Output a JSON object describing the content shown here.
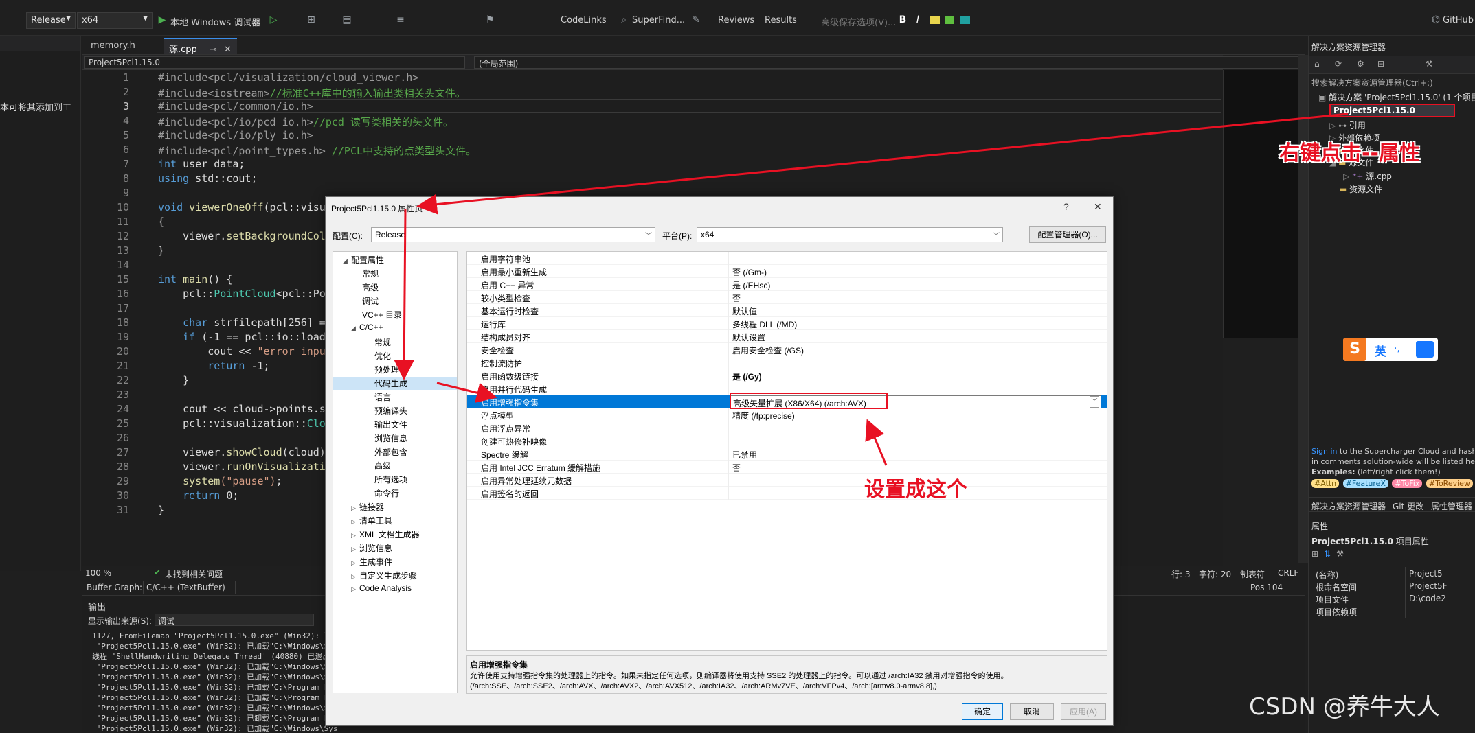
{
  "toolbar": {
    "config": "Release",
    "platform": "x64",
    "debugger": "本地 Windows 调试器",
    "codelinks": "CodeLinks",
    "superfind": "SuperFind...",
    "reviews": "Reviews",
    "results": "Results",
    "savecache": "高级保存选项(V)...",
    "github": "GitHub"
  },
  "left_panel": {
    "hint": "本可将其添加到工"
  },
  "editor": {
    "tabs": [
      "memory.h",
      "源.cpp"
    ],
    "nav_left": "Project5Pcl1.15.0",
    "nav_right": "(全局范围)",
    "line_numbers": [
      "1",
      "2",
      "3",
      "4",
      "5",
      "6",
      "7",
      "8",
      "9",
      "10",
      "11",
      "12",
      "13",
      "14",
      "15",
      "16",
      "17",
      "18",
      "19",
      "20",
      "21",
      "22",
      "23",
      "24",
      "25",
      "26",
      "27",
      "28",
      "29",
      "30",
      "31"
    ],
    "lines": {
      "l1": "#include<pcl/visualization/cloud_viewer.h>",
      "l2a": "#include<iostream>",
      "l2b": "//标准C++库中的输入输出类相关头文件。",
      "l3": "#include<pcl/common/io.h>",
      "l4a": "#include<pcl/io/pcd_io.h>",
      "l4b": "//pcd 读写类相关的头文件。",
      "l5": "#include<pcl/io/ply_io.h>",
      "l6a": "#include<pcl/point_types.h> ",
      "l6b": "//PCL中支持的点类型头文件。",
      "l7a": "int",
      "l7b": " user_data;",
      "l8a": "using",
      "l8b": " std::cout;",
      "l10a": "void",
      "l10b": "viewerOneOff",
      "l10c": "(pcl::visu",
      "l11": "{",
      "l12a": "    viewer.",
      "l12b": "setBackgroundCol",
      "l13": "}",
      "l15a": "int",
      "l15b": "main",
      "l15c": "() {",
      "l16a": "    pcl::",
      "l16b": "PointCloud",
      "l16c": "<pcl::Po",
      "l18a": "    char",
      "l18b": " strfilepath[256] =",
      "l19a": "    if",
      "l19b": " (-1 == pcl::io::load",
      "l20a": "        cout << ",
      "l20b": "\"error inpu",
      "l21a": "        return",
      "l21b": " -1;",
      "l22": "    }",
      "l24": "    cout << cloud->points.s",
      "l25a": "    pcl::visualization::",
      "l25b": "Clo",
      "l27a": "    viewer.",
      "l27b": "showCloud",
      "l27c": "(cloud)",
      "l28a": "    viewer.",
      "l28b": "runOnVisualizati",
      "l29a": "    system",
      "l29b": "(\"pause\")",
      "l29c": ";",
      "l30a": "    return",
      "l30b": " 0;",
      "l31": "}"
    }
  },
  "edstatus": {
    "zoom": "100 %",
    "issues": "未找到相关问题",
    "line": "行: 3",
    "char": "字符: 20",
    "tabs": "制表符",
    "eol": "CRLF"
  },
  "bufferbar": {
    "label": "Buffer Graph:",
    "value": "C/C++ (TextBuffer)",
    "pos": "Pos 104"
  },
  "output": {
    "title": "输出",
    "source_label": "显示输出来源(S):",
    "source_value": "调试",
    "lines": [
      "1127, FromFilemap \"Project5Pcl1.15.0.exe\" (Win32): 已加载",
      " \"Project5Pcl1.15.0.exe\" (Win32): 已加载\"C:\\Windows\\Sys",
      "线程 'ShellHandwriting Delegate Thread' (40880) 已退出,",
      " \"Project5Pcl1.15.0.exe\" (Win32): 已加载\"C:\\Windows\\Sys",
      " \"Project5Pcl1.15.0.exe\" (Win32): 已加载\"C:\\Windows\\Sys",
      " \"Project5Pcl1.15.0.exe\" (Win32): 已加载\"C:\\Program File",
      " \"Project5Pcl1.15.0.exe\" (Win32): 已加载\"C:\\Program File",
      " \"Project5Pcl1.15.0.exe\" (Win32): 已加载\"C:\\Windows\\Sys",
      " \"Project5Pcl1.15.0.exe\" (Win32): 已卸载\"C:\\Program File",
      " \"Project5Pcl1.15.0.exe\" (Win32): 已加载\"C:\\Windows\\Sys",
      " \"Project5Pcl1.15.0.exe\" (Win32): 已卸载\"C:\\Windows\\Sys"
    ]
  },
  "solution_explorer": {
    "title": "解决方案资源管理器",
    "search": "搜索解决方案资源管理器(Ctrl+;)",
    "solution": "解决方案 'Project5Pcl1.15.0' (1 个项目",
    "project": "Project5Pcl1.15.0",
    "ref": "引用",
    "external": "外部依赖项",
    "header": "头文件",
    "source": "源文件",
    "src_cpp": "源.cpp",
    "res": "资源文件",
    "tip1a": "Sign in",
    "tip1b": " to the Supercharger Cloud and hash",
    "tip2": "in comments solution-wide will be listed her",
    "tip3a": "Examples:",
    "tip3b": " (left/right click them!)",
    "tags": [
      "#Attn",
      "#FeatureX",
      "#ToFix",
      "#ToReview"
    ],
    "bottom_tabs": [
      "解决方案资源管理器",
      "Git 更改",
      "属性管理器"
    ],
    "props_title": "属性",
    "props_object": "Project5Pcl1.15.0",
    "props_object_type": "项目属性",
    "props_rows": [
      {
        "k": "(名称)",
        "v": "Project5"
      },
      {
        "k": "根命名空间",
        "v": "Project5F"
      },
      {
        "k": "项目文件",
        "v": "D:\\code2"
      },
      {
        "k": "项目依赖项",
        "v": ""
      }
    ]
  },
  "dialog": {
    "title": "Project5Pcl1.15.0 属性页",
    "help": "?",
    "close": "✕",
    "config_label": "配置(C):",
    "config_value": "Release",
    "platform_label": "平台(P):",
    "platform_value": "x64",
    "config_mgr": "配置管理器(O)...",
    "tree": [
      {
        "label": "配置属性",
        "exp": "◢"
      },
      {
        "label": "常规"
      },
      {
        "label": "高级"
      },
      {
        "label": "调试"
      },
      {
        "label": "VC++ 目录"
      },
      {
        "label": "C/C++",
        "exp": "◢"
      },
      {
        "label": "常规"
      },
      {
        "label": "优化"
      },
      {
        "label": "预处理器"
      },
      {
        "label": "代码生成",
        "sel": true
      },
      {
        "label": "语言"
      },
      {
        "label": "预编译头"
      },
      {
        "label": "输出文件"
      },
      {
        "label": "浏览信息"
      },
      {
        "label": "外部包含"
      },
      {
        "label": "高级"
      },
      {
        "label": "所有选项"
      },
      {
        "label": "命令行"
      },
      {
        "label": "链接器",
        "exp": "▷"
      },
      {
        "label": "清单工具",
        "exp": "▷"
      },
      {
        "label": "XML 文档生成器",
        "exp": "▷"
      },
      {
        "label": "浏览信息",
        "exp": "▷"
      },
      {
        "label": "生成事件",
        "exp": "▷"
      },
      {
        "label": "自定义生成步骤",
        "exp": "▷"
      },
      {
        "label": "Code Analysis",
        "exp": "▷"
      }
    ],
    "props": [
      {
        "n": "启用字符串池",
        "v": ""
      },
      {
        "n": "启用最小重新生成",
        "v": "否 (/Gm-)"
      },
      {
        "n": "启用 C++ 异常",
        "v": "是 (/EHsc)"
      },
      {
        "n": "较小类型检查",
        "v": "否"
      },
      {
        "n": "基本运行时检查",
        "v": "默认值"
      },
      {
        "n": "运行库",
        "v": "多线程 DLL (/MD)"
      },
      {
        "n": "结构成员对齐",
        "v": "默认设置"
      },
      {
        "n": "安全检查",
        "v": "启用安全检查 (/GS)"
      },
      {
        "n": "控制流防护",
        "v": ""
      },
      {
        "n": "启用函数级链接",
        "v": "是 (/Gy)",
        "bold": true
      },
      {
        "n": "启用并行代码生成",
        "v": ""
      },
      {
        "n": "启用增强指令集",
        "v": "高级矢量扩展 (X86/X64) (/arch:AVX)",
        "sel": true
      },
      {
        "n": "浮点模型",
        "v": "精度 (/fp:precise)"
      },
      {
        "n": "启用浮点异常",
        "v": ""
      },
      {
        "n": "创建可热修补映像",
        "v": ""
      },
      {
        "n": "Spectre 缓解",
        "v": "已禁用"
      },
      {
        "n": "启用 Intel JCC Erratum 缓解措施",
        "v": "否"
      },
      {
        "n": "启用异常处理延续元数据",
        "v": ""
      },
      {
        "n": "启用签名的返回",
        "v": ""
      }
    ],
    "desc_title": "启用增强指令集",
    "desc_text": "允许使用支持增强指令集的处理器上的指令。如果未指定任何选项，则编译器将使用支持 SSE2 的处理器上的指令。可以通过 /arch:IA32 禁用对增强指令的使用。(/arch:SSE、/arch:SSE2、/arch:AVX、/arch:AVX2、/arch:AVX512、/arch:IA32、/arch:ARMv7VE、/arch:VFPv4、/arch:[armv8.0-armv8.8],)",
    "ok": "确定",
    "cancel": "取消",
    "apply": "应用(A)"
  },
  "annotations": {
    "right_click": "右键点击--属性",
    "set_this": "设置成这个",
    "color": "#e81123"
  },
  "ime": {
    "label": "英"
  },
  "watermark": "CSDN @养牛大人"
}
